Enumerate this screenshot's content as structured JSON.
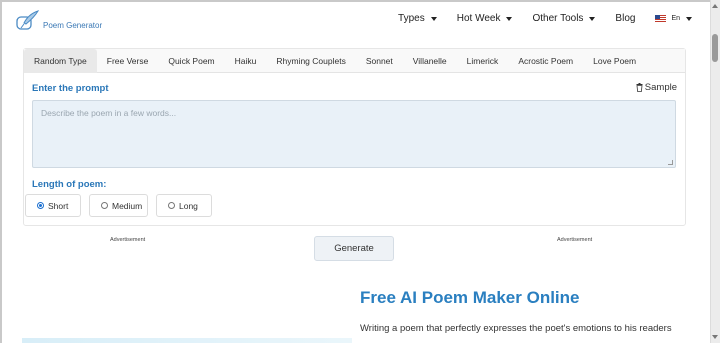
{
  "header": {
    "logo_text": "Poem Generator",
    "nav": [
      {
        "label": "Types",
        "has_dropdown": true
      },
      {
        "label": "Hot Week",
        "has_dropdown": true
      },
      {
        "label": "Other Tools",
        "has_dropdown": true
      },
      {
        "label": "Blog",
        "has_dropdown": false
      }
    ],
    "language": {
      "label": "En",
      "flag_icon": "us-flag-icon"
    }
  },
  "tabs": {
    "active": "Random Type",
    "items": [
      {
        "label": "Random Type"
      },
      {
        "label": "Free Verse"
      },
      {
        "label": "Quick Poem"
      },
      {
        "label": "Haiku"
      },
      {
        "label": "Rhyming Couplets"
      },
      {
        "label": "Sonnet"
      },
      {
        "label": "Villanelle"
      },
      {
        "label": "Limerick"
      },
      {
        "label": "Acrostic Poem"
      },
      {
        "label": "Love Poem"
      }
    ]
  },
  "prompt": {
    "label": "Enter the prompt",
    "sample_label": "Sample",
    "placeholder": "Describe the poem in a few words...",
    "value": ""
  },
  "length": {
    "label": "Length of poem:",
    "selected": "Short",
    "options": [
      {
        "label": "Short",
        "checked": true
      },
      {
        "label": "Medium",
        "checked": false
      },
      {
        "label": "Long",
        "checked": false
      }
    ]
  },
  "ads": {
    "left": "Advertisement",
    "right": "Advertisement"
  },
  "generate_label": "Generate",
  "content": {
    "title": "Free AI Poem Maker Online",
    "intro": "Writing a poem that perfectly expresses the poet's emotions to his readers"
  },
  "colors": {
    "accent": "#2a77b8",
    "title": "#2a7fc0",
    "textarea_bg": "#e9f1f8"
  }
}
